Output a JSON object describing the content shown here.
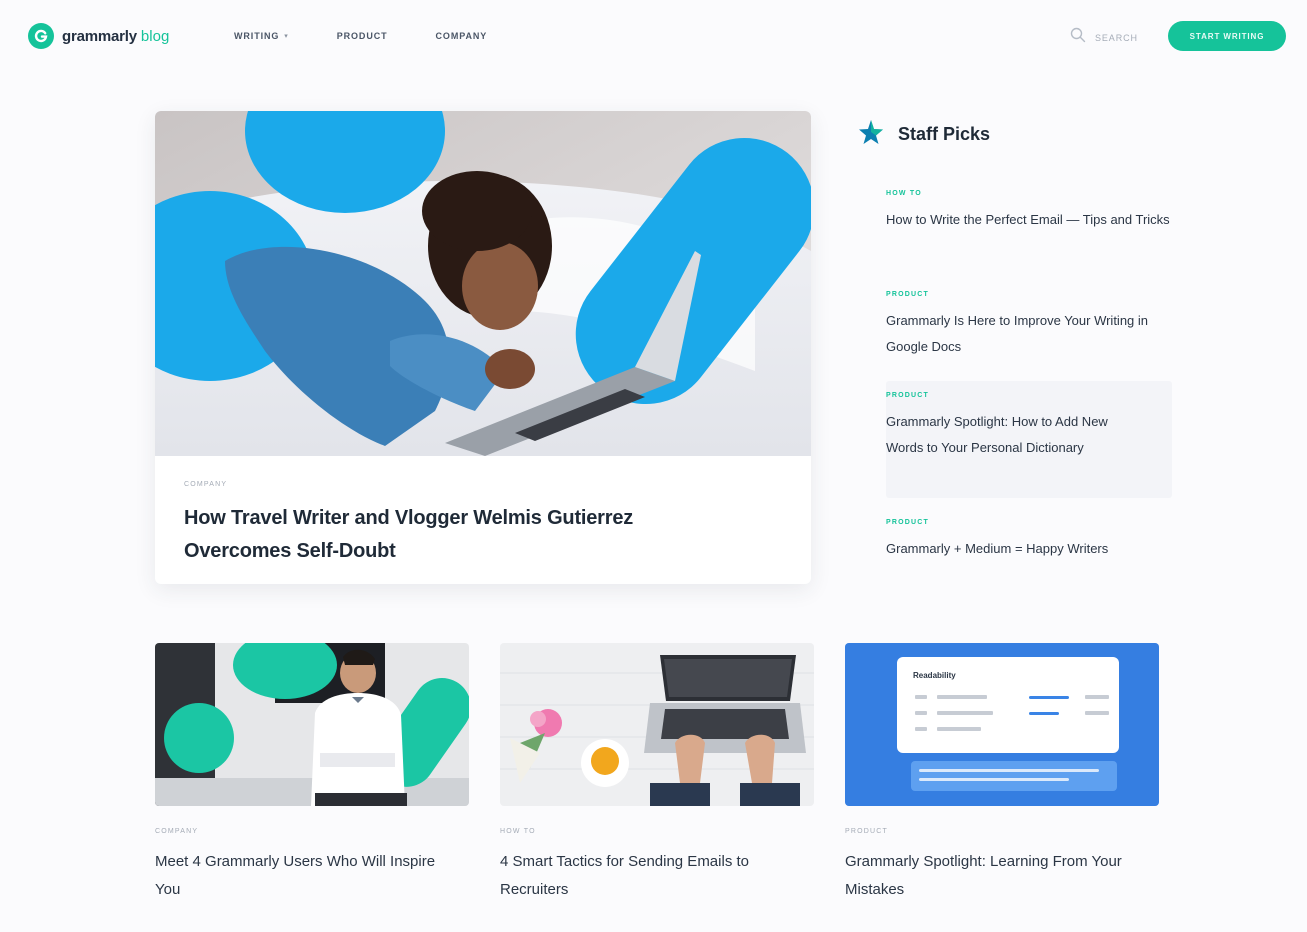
{
  "header": {
    "logo_word": "grammarly",
    "logo_sub": "blog",
    "nav": [
      {
        "label": "WRITING",
        "has_dropdown": true
      },
      {
        "label": "PRODUCT",
        "has_dropdown": false
      },
      {
        "label": "COMPANY",
        "has_dropdown": false
      }
    ],
    "search_label": "SEARCH",
    "cta_label": "START WRITING"
  },
  "hero": {
    "category": "COMPANY",
    "title": "How Travel Writer and Vlogger Welmis Gutierrez Overcomes Self-Doubt"
  },
  "staff_picks": {
    "title": "Staff Picks",
    "items": [
      {
        "category": "HOW TO",
        "title": "How to Write the Perfect Email — Tips and Tricks"
      },
      {
        "category": "PRODUCT",
        "title": "Grammarly Is Here to Improve Your Writing in Google Docs"
      },
      {
        "category": "PRODUCT",
        "title": "Grammarly Spotlight: How to Add New Words to Your Personal Dictionary",
        "highlighted": true
      },
      {
        "category": "PRODUCT",
        "title": "Grammarly + Medium = Happy Writers"
      }
    ]
  },
  "cards": [
    {
      "category": "COMPANY",
      "title": "Meet 4 Grammarly Users Who Will Inspire You"
    },
    {
      "category": "HOW TO",
      "title": "4 Smart Tactics for Sending Emails to Recruiters"
    },
    {
      "category": "PRODUCT",
      "title": "Grammarly Spotlight: Learning From Your Mistakes"
    }
  ],
  "readability_preview": {
    "heading": "Readability"
  },
  "colors": {
    "brand": "#15c39a",
    "hero_shape": "#1ba9ea",
    "background": "#fbfbfd"
  }
}
